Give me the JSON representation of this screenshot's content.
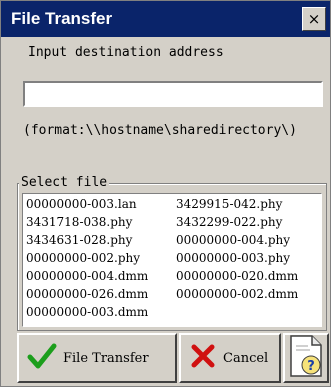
{
  "window": {
    "title": "File Transfer",
    "close_glyph": "×"
  },
  "address": {
    "prompt": "Input destination address",
    "value": "",
    "format_hint": "(format:\\\\hostname\\sharedirectory\\)"
  },
  "select_file": {
    "label": "Select file",
    "files": [
      "00000000-003.lan",
      "3429915-042.phy",
      "3431718-038.phy",
      "3432299-022.phy",
      "3434631-028.phy",
      "00000000-004.phy",
      "00000000-002.phy",
      "00000000-003.phy",
      "00000000-004.dmm",
      "00000000-020.dmm",
      "00000000-026.dmm",
      "00000000-002.dmm",
      "00000000-003.dmm"
    ]
  },
  "buttons": {
    "transfer_label": "File Transfer",
    "cancel_label": "Cancel",
    "transfer_icon": "checkmark-icon",
    "cancel_icon": "x-icon",
    "help_icon": "help-document-icon"
  },
  "colors": {
    "title_bar": "#0a246a",
    "check": "#1c9e1c",
    "cancel_x": "#d01010",
    "face": "#d4d0c8"
  }
}
